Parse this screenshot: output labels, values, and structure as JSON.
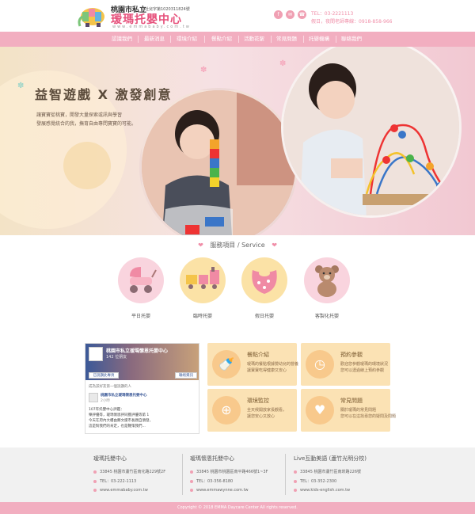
{
  "header": {
    "city_label": "桃園市私立",
    "license": "府社兒字第1020311824號",
    "brand_name": "瑷瑪托嬰中心",
    "url": "www.emmababy.com.tw",
    "contact_tel": "TEL：03-2221113",
    "contact_hours": "假日，夜間老師專線：0918-858-966",
    "social_icons": [
      "facebook-icon",
      "mail-icon",
      "phone-icon"
    ],
    "accent_color": "#e6507b"
  },
  "nav": {
    "items": [
      "認識我們",
      "最新消息",
      "環境介紹",
      "餐點介紹",
      "活動花絮",
      "常見問題",
      "托嬰機構",
      "聯絡我們"
    ]
  },
  "hero": {
    "title": "益智遊戲 X 激發創意",
    "sub1": "讓寶寶從桃寶，開發大量探索或訊與學習",
    "sub2": "發展感覺統合的我，撫育自由專問寶寶的可能。"
  },
  "services": {
    "heading": "服務項目 / Service",
    "items": [
      {
        "label": "平日托嬰",
        "icon": "stroller-icon"
      },
      {
        "label": "臨時托嬰",
        "icon": "train-icon"
      },
      {
        "label": "假日托嬰",
        "icon": "bib-icon"
      },
      {
        "label": "客製化托嬰",
        "icon": "teddy-bear-icon"
      }
    ]
  },
  "facebook": {
    "page_name": "桃園市私立瑷瑪懷恩托嬰中心",
    "likes": "142 位朋友",
    "like_button": "已說讚此專頁",
    "share_button": "聯絡資訊",
    "friend_note": "成為該好友第一個說讚的人",
    "post_name": "桃園市私立瑷瑪懷恩托嬰中心",
    "post_time": "2小時",
    "post_lines": [
      "107年托嬰中心評鑑：",
      "樂評優等，瑷瑪懷恩評同獲評優等第 1",
      "今天在府內大樓由鄭文燦市長親自頒發，",
      "這是對我們的肯定，也是鞭策我們..."
    ]
  },
  "cards": [
    {
      "title": "餐點介紹",
      "icon": "food-icon",
      "desc1": "瑷瑪的餐點根據嬰幼兒的營養",
      "desc2": "讓寶寶吃得健康又安心"
    },
    {
      "title": "預約參觀",
      "icon": "clock-icon",
      "desc1": "歡迎您參觀瑷瑪的環境狀況",
      "desc2": "您可以透過線上預約參觀"
    },
    {
      "title": "環境監控",
      "icon": "target-icon",
      "desc1": "全天候開放家長觀看，",
      "desc2": "讓您安心又放心"
    },
    {
      "title": "常見問題",
      "icon": "heart-chat-icon",
      "desc1": "關於瑷瑪的常見問題",
      "desc2": "您可以在這找尋您的疑問及問題"
    }
  ],
  "footer": {
    "columns": [
      {
        "title": "瑷瑪托嬰中心",
        "address": "33845 桃園市蘆竹區南化路229號2F",
        "tel": "TEL：03-222-1113",
        "web": "www.emmababy.com.tw"
      },
      {
        "title": "瑷瑪懷恩托嬰中心",
        "address": "33845 桃園市桃園區南平路466號1~3F",
        "tel": "TEL：03-356-8180",
        "web": "www.emmawynne.com.tw"
      },
      {
        "title": "Live互動美語 (蘆竹光明分校)",
        "address": "33845 桃園市蘆竹區南崁路226號",
        "tel": "TEL：03-352-2300",
        "web": "www.kids-english.com.tw"
      }
    ],
    "copyright": "Copyright © 2018 EMMA Daycare Center All rights reserved."
  }
}
